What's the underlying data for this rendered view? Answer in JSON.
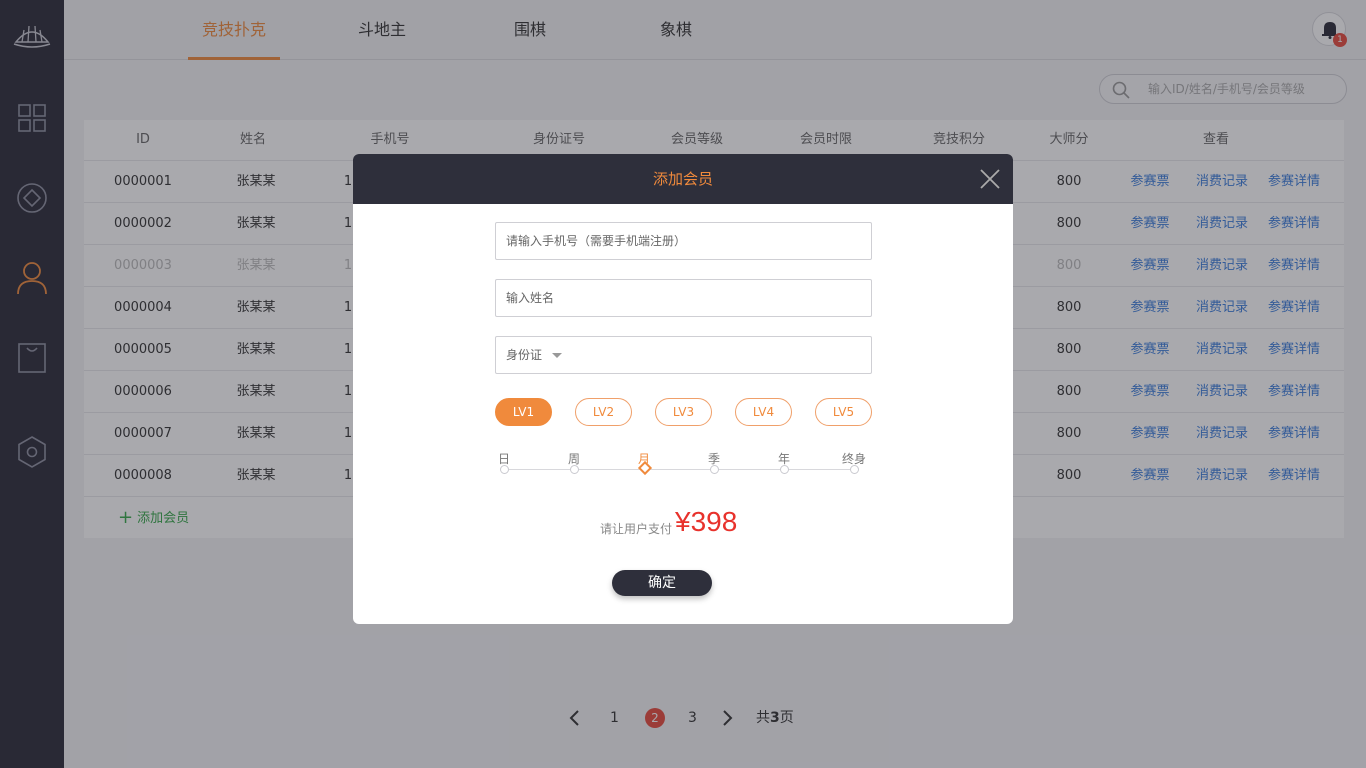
{
  "tabs": [
    {
      "label": "竞技扑克",
      "active": true
    },
    {
      "label": "斗地主",
      "active": false
    },
    {
      "label": "围棋",
      "active": false
    },
    {
      "label": "象棋",
      "active": false
    }
  ],
  "notifications": {
    "count": "1"
  },
  "search": {
    "placeholder": "输入ID/姓名/手机号/会员等级"
  },
  "table": {
    "headers": [
      "ID",
      "姓名",
      "手机号",
      "身份证号",
      "会员等级",
      "会员时限",
      "竞技积分",
      "大师分",
      "查看"
    ],
    "rows": [
      {
        "id": "0000001",
        "name": "张某某",
        "phone": "1",
        "master": "800",
        "dim": false
      },
      {
        "id": "0000002",
        "name": "张某某",
        "phone": "1",
        "master": "800",
        "dim": false
      },
      {
        "id": "0000003",
        "name": "张某某",
        "phone": "1",
        "master": "800",
        "dim": true
      },
      {
        "id": "0000004",
        "name": "张某某",
        "phone": "1",
        "master": "800",
        "dim": false
      },
      {
        "id": "0000005",
        "name": "张某某",
        "phone": "1",
        "master": "800",
        "dim": false
      },
      {
        "id": "0000006",
        "name": "张某某",
        "phone": "1",
        "master": "800",
        "dim": false
      },
      {
        "id": "0000007",
        "name": "张某某",
        "phone": "1",
        "master": "800",
        "dim": false
      },
      {
        "id": "0000008",
        "name": "张某某",
        "phone": "1",
        "master": "800",
        "dim": false
      }
    ],
    "link_labels": [
      "参赛票",
      "消费记录",
      "参赛详情"
    ],
    "add_label": "添加会员"
  },
  "pager": {
    "pages": [
      "1",
      "2",
      "3"
    ],
    "current": "2",
    "total_prefix": "共",
    "total_num": "3",
    "total_suffix": "页"
  },
  "modal": {
    "title": "添加会员",
    "phone_placeholder": "请输入手机号（需要手机端注册）",
    "name_placeholder": "输入姓名",
    "id_type": "身份证",
    "levels": [
      {
        "label": "LV1",
        "selected": true
      },
      {
        "label": "LV2",
        "selected": false
      },
      {
        "label": "LV3",
        "selected": false
      },
      {
        "label": "LV4",
        "selected": false
      },
      {
        "label": "LV5",
        "selected": false
      }
    ],
    "periods": [
      {
        "label": "日",
        "selected": false
      },
      {
        "label": "周",
        "selected": false
      },
      {
        "label": "月",
        "selected": true
      },
      {
        "label": "季",
        "selected": false
      },
      {
        "label": "年",
        "selected": false
      },
      {
        "label": "终身",
        "selected": false
      }
    ],
    "pay_hint": "请让用户支付",
    "pay_amount": "¥398",
    "confirm_label": "确定"
  },
  "colors": {
    "accent": "#f08a3c",
    "sidebar": "#2a2b38",
    "link": "#3b7ddd",
    "price": "#e8322c",
    "add": "#36a84a"
  }
}
